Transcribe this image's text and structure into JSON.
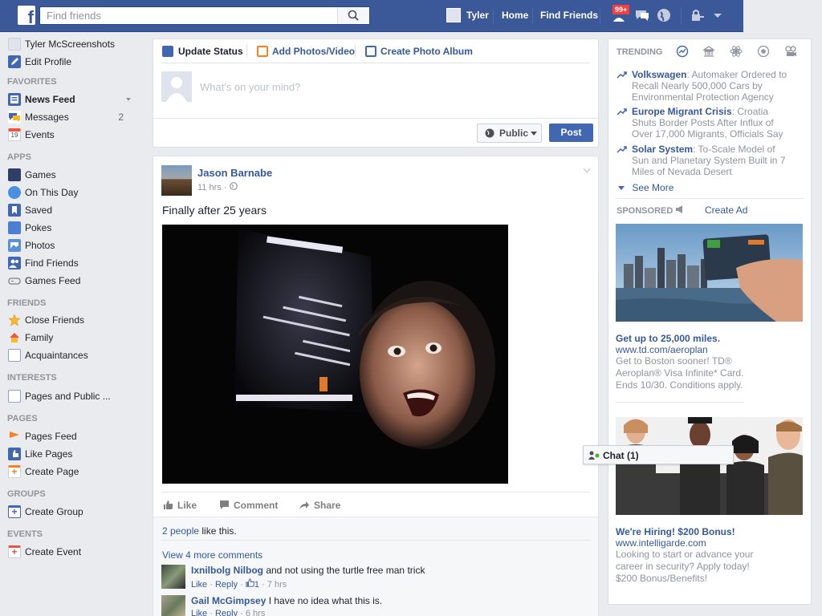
{
  "topbar": {
    "logo": "f",
    "search_placeholder": "Find friends",
    "user_name": "Tyler",
    "home": "Home",
    "find_friends": "Find Friends",
    "notif_badge": "99+"
  },
  "sidebar": {
    "profile_name": "Tyler McScreenshots",
    "edit_profile": "Edit Profile",
    "favorites_head": "FAVORITES",
    "news_feed": "News Feed",
    "messages": "Messages",
    "messages_count": "2",
    "events": "Events",
    "apps_head": "APPS",
    "apps": [
      "Games",
      "On This Day",
      "Saved",
      "Pokes",
      "Photos",
      "Find Friends",
      "Games Feed"
    ],
    "friends_head": "FRIENDS",
    "friends": [
      "Close Friends",
      "Family",
      "Acquaintances"
    ],
    "interests_head": "INTERESTS",
    "interests": [
      "Pages and Public ..."
    ],
    "pages_head": "PAGES",
    "pages": [
      "Pages Feed",
      "Like Pages",
      "Create Page"
    ],
    "groups_head": "GROUPS",
    "groups": [
      "Create Group"
    ],
    "events_head": "EVENTS",
    "events_items": [
      "Create Event"
    ]
  },
  "composer": {
    "tab_status": "Update Status",
    "tab_photo": "Add Photos/Video",
    "tab_album": "Create Photo Album",
    "placeholder": "What's on your mind?",
    "privacy": "Public",
    "post": "Post"
  },
  "post": {
    "author": "Jason Barnabe",
    "time": "11 hrs · ",
    "text": "Finally after 25 years",
    "like": "Like",
    "comment": "Comment",
    "share": "Share",
    "likes_link": "2 people",
    "likes_rest": " like this.",
    "view_more": "View 4 more comments",
    "comments": [
      {
        "name": "Ixnilbolg Nilbog",
        "text": " and not using the turtle free man trick",
        "meta_like": "Like",
        "meta_reply": "Reply",
        "meta_count": "1",
        "meta_time": "7 hrs"
      },
      {
        "name": "Gail McGimpsey",
        "text": " I have no idea what this is.",
        "meta_like": "Like",
        "meta_reply": "Reply",
        "meta_time": "6 hrs"
      }
    ]
  },
  "trending": {
    "heading": "TRENDING",
    "items": [
      {
        "topic": "Volkswagen",
        "desc": ": Automaker Ordered to Recall Nearly 500,000 Cars by Environmental Protection Agency"
      },
      {
        "topic": "Europe Migrant Crisis",
        "desc": ": Croatia Shuts Border Posts After Influx of Over 17,000 Migrants, Officials Say"
      },
      {
        "topic": "Solar System",
        "desc": ": To-Scale Model of Sun and Planetary System Built in 7 Miles of Nevada Desert"
      }
    ],
    "see_more": "See More"
  },
  "sponsored": {
    "heading": "SPONSORED",
    "create_ad": "Create Ad",
    "ads": [
      {
        "title": "Get up to 25,000 miles.",
        "url": "www.td.com/aeroplan",
        "desc": "Get to Boston sooner! TD® Aeroplan® Visa Infinite* Card. Ends 10/30. Conditions apply."
      },
      {
        "title": "We're Hiring! $200 Bonus!",
        "url": "www.intelligarde.com",
        "desc": "Looking to start or advance your career in security? Apply today! $200 Bonus/Benefits!"
      }
    ]
  },
  "chat": {
    "label": "Chat (1)"
  },
  "colors": {
    "brand": "#3b5998",
    "link": "#365899",
    "badge": "#fa3e3e",
    "post_button": "#4267b2"
  }
}
